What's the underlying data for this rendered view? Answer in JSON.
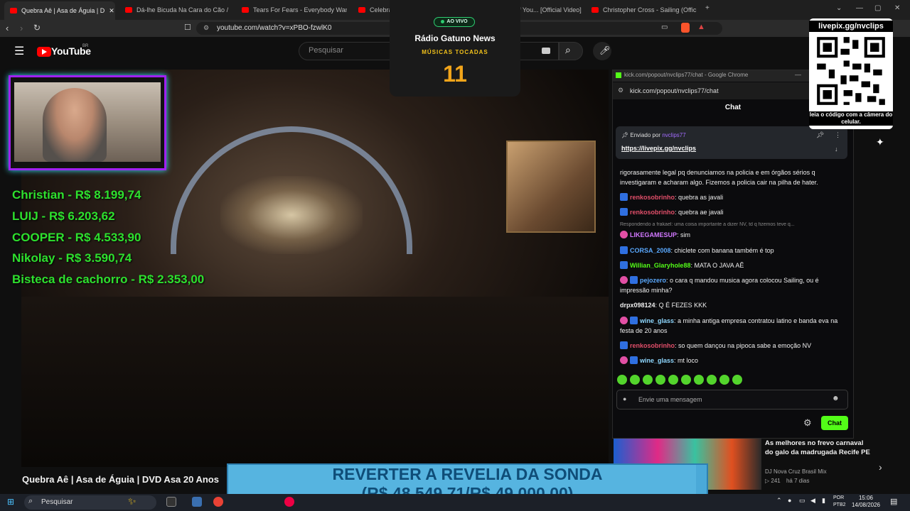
{
  "browser": {
    "tabs": [
      {
        "title": "Quebra Aê | Asa de Águia | D",
        "active": true
      },
      {
        "title": "Dá-lhe Bicuda Na Cara do Cão / C",
        "active": false
      },
      {
        "title": "Tears For Fears - Everybody Wants To",
        "active": false
      },
      {
        "title": "Celebrati",
        "active": false
      },
      {
        "title": "f You... [Official Video]",
        "active": false
      },
      {
        "title": "Christopher Cross - Sailing (Official M",
        "active": false
      }
    ],
    "url": "youtube.com/watch?v=xPBO-fzwlK0"
  },
  "youtube": {
    "logo_text": "YouTube",
    "region": "BR",
    "search_placeholder": "Pesquisar",
    "video_title": "Quebra Aê | Asa de Águia | DVD Asa 20 Anos"
  },
  "donations": [
    "Christian - R$ 8.199,74",
    "LUIJ - R$ 6.203,62",
    "COOPER - R$ 4.533,90",
    "Nikolay - R$ 3.590,74",
    "Bisteca de cachorro - R$ 2.353,00"
  ],
  "radio": {
    "status": "AO VIVO",
    "name": "Rádio Gatuno News",
    "subtitle": "MÚSICAS TOCADAS",
    "count": "11"
  },
  "chat": {
    "window_title": "kick.com/popout/nvclips77/chat - Google Chrome",
    "url": "kick.com/popout/nvclips77/chat",
    "header": "Chat",
    "pinned": {
      "prefix": "Enviado por",
      "user": "nvclips77",
      "link": "https://livepix.gg/nvclips"
    },
    "messages": [
      {
        "user": "",
        "color": "#efefef",
        "text": "rigorasamente legal pq denunciamos na policia e em órgãos sérios q investigaram e acharam algo. Fizemos a policia cair na pilha de hater."
      },
      {
        "user": "renkosobrinho",
        "color": "#e24f6a",
        "text": "quebra as javali"
      },
      {
        "user": "renkosobrinho",
        "color": "#e24f6a",
        "text": "quebra ae javali"
      },
      {
        "user": "LIKEGAMESUP",
        "color": "#d278ff",
        "text": "sim"
      },
      {
        "user": "CORSA_2008",
        "color": "#5aa9ff",
        "text": "chiclete com banana também é top"
      },
      {
        "user": "Willian_Glaryhole88",
        "color": "#53fc18",
        "text": "MATA O JAVA AÊ"
      },
      {
        "user": "pejozero",
        "color": "#5aa9ff",
        "text": "o cara q mandou musica agora colocou Sailing, ou é impressão minha?"
      },
      {
        "user": "drpx098124",
        "color": "#efefef",
        "text": "Q É FEZES KKK"
      },
      {
        "user": "wine_glass",
        "color": "#8fd8ff",
        "text": "a minha antiga empresa contratou latino e banda eva na festa de 20 anos"
      },
      {
        "user": "renkosobrinho",
        "color": "#e24f6a",
        "text": "so quem dançou na pipoca sabe a emoção NV"
      },
      {
        "user": "wine_glass",
        "color": "#8fd8ff",
        "text": "mt loco"
      }
    ],
    "reply_note": "Respondendo a frakael: uma coisa importante a dizer NV, td q fizemos teve q...",
    "input_placeholder": "Envie uma mensagem",
    "send_label": "Chat"
  },
  "qr": {
    "title": "livepix.gg/nvclips",
    "caption": "leia o código com a câmera do celular."
  },
  "recommended": {
    "title": "As melhores no frevo carnaval do galo da madrugada Recife PE",
    "channel": "DJ Nova Cruz Brasil Mix",
    "views": "241",
    "age": "há 7 dias"
  },
  "goal": {
    "line1": "REVERTER A REVELIA DA SONDA",
    "line2": "(R$ 48.549,71/R$ 49.000,00)",
    "progress": 0.9908
  },
  "taskbar": {
    "search": "Pesquisar",
    "lang": "POR PTB2",
    "time": "15:06",
    "date": "14/08/2026"
  },
  "colors": {
    "accent_green": "#53fc18",
    "donation_green": "#2ee02e",
    "radio_gold": "#f2a51a",
    "goal_blue": "#4aa9d8",
    "youtube_red": "#ff0000"
  }
}
